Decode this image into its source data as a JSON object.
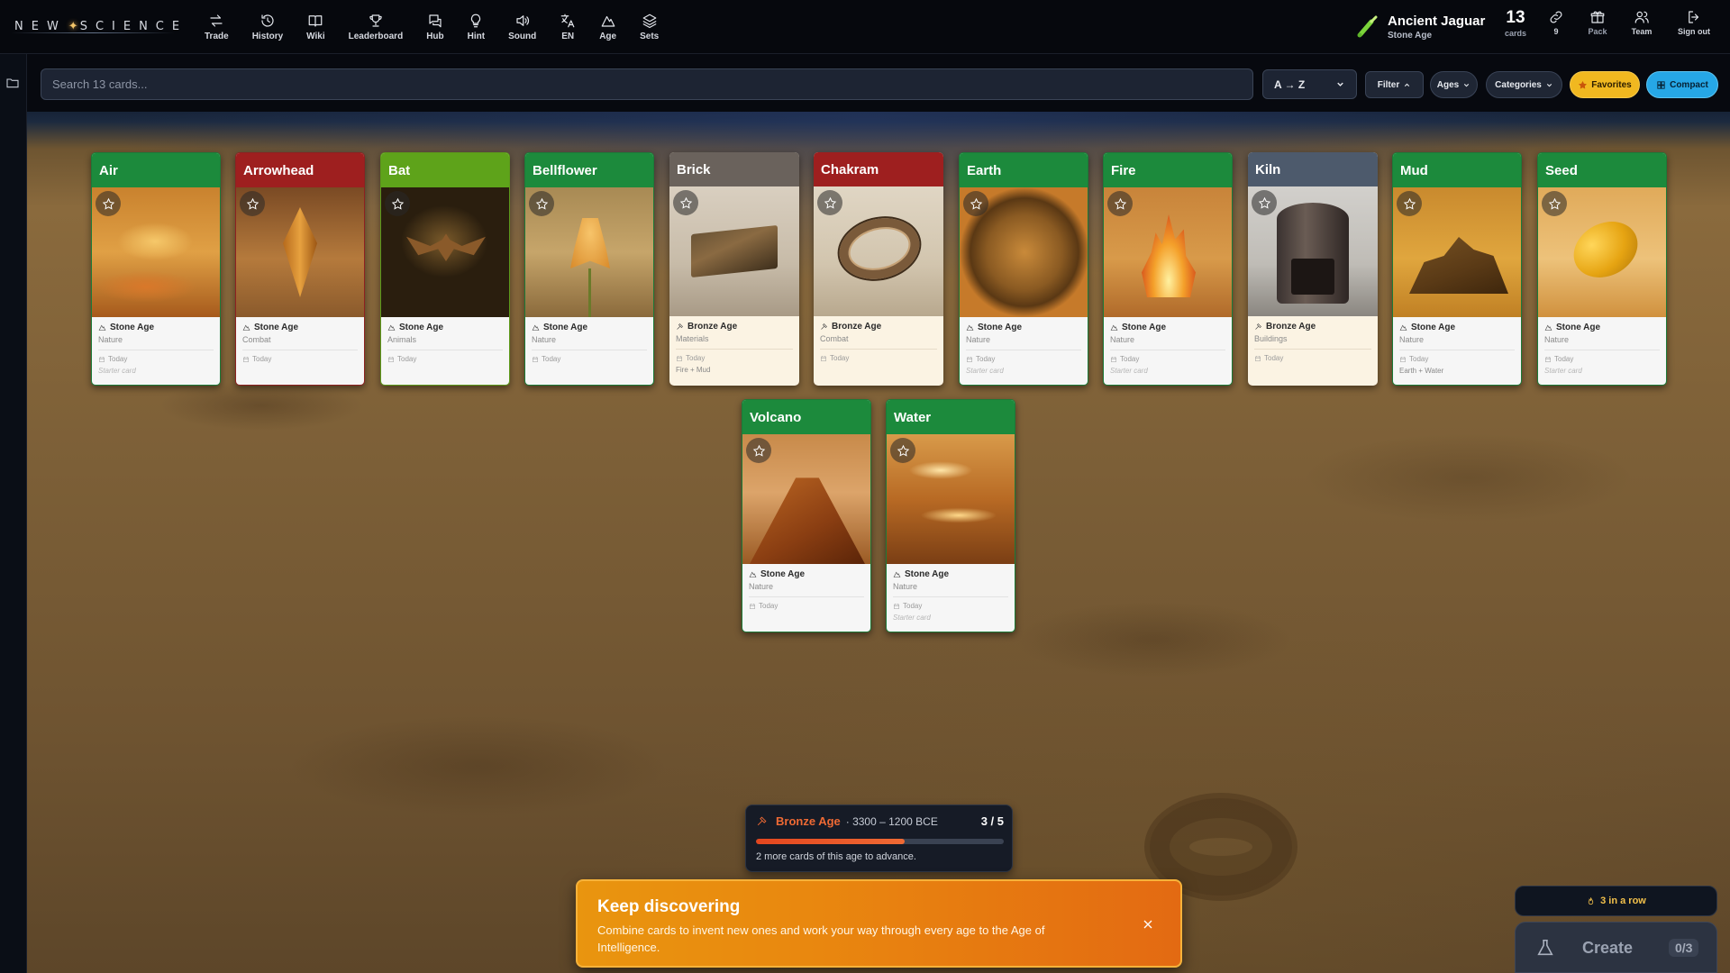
{
  "header": {
    "logo_left": "NEW",
    "logo_star": "✦",
    "logo_right": "SCIENCE",
    "nav": [
      {
        "label": "Trade",
        "icon": "arrows-exchange-icon"
      },
      {
        "label": "History",
        "icon": "history-icon"
      },
      {
        "label": "Wiki",
        "icon": "book-icon"
      },
      {
        "label": "Leaderboard",
        "icon": "trophy-icon"
      },
      {
        "label": "Hub",
        "icon": "chat-icon"
      },
      {
        "label": "Hint",
        "icon": "lightbulb-icon"
      },
      {
        "label": "Sound",
        "icon": "speaker-icon"
      },
      {
        "label": "EN",
        "icon": "translate-icon"
      },
      {
        "label": "Age",
        "icon": "mountain-icon"
      },
      {
        "label": "Sets",
        "icon": "layers-icon"
      }
    ],
    "user": {
      "name": "Ancient Jaguar",
      "age": "Stone Age"
    },
    "cards_count": "13",
    "cards_label": "cards",
    "links_count": "9",
    "pack_label": "Pack",
    "team_label": "Team",
    "signout_label": "Sign out"
  },
  "toolbar": {
    "search_placeholder": "Search 13 cards...",
    "sort_value": "A → Z",
    "filter_label": "Filter",
    "ages_label": "Ages",
    "categories_label": "Categories",
    "favorites_label": "Favorites",
    "compact_label": "Compact"
  },
  "colors": {
    "nature_green": "#1c8a3c",
    "combat_red": "#9e1f1f",
    "animals_lime": "#5ea31a",
    "materials_gray": "#6a625c",
    "buildings_slate": "#4d5a6c",
    "bronze_accent": "#ef6a34",
    "favorites_yellow": "#f1b820",
    "compact_blue": "#26a7e6"
  },
  "cards": [
    {
      "name": "Air",
      "age": "Stone Age",
      "category": "Nature",
      "date": "Today",
      "note": "Starter card"
    },
    {
      "name": "Arrowhead",
      "age": "Stone Age",
      "category": "Combat",
      "date": "Today",
      "note": ""
    },
    {
      "name": "Bat",
      "age": "Stone Age",
      "category": "Animals",
      "date": "Today",
      "note": ""
    },
    {
      "name": "Bellflower",
      "age": "Stone Age",
      "category": "Nature",
      "date": "Today",
      "note": ""
    },
    {
      "name": "Brick",
      "age": "Bronze Age",
      "category": "Materials",
      "date": "Today",
      "note": "Fire + Mud"
    },
    {
      "name": "Chakram",
      "age": "Bronze Age",
      "category": "Combat",
      "date": "Today",
      "note": ""
    },
    {
      "name": "Earth",
      "age": "Stone Age",
      "category": "Nature",
      "date": "Today",
      "note": "Starter card"
    },
    {
      "name": "Fire",
      "age": "Stone Age",
      "category": "Nature",
      "date": "Today",
      "note": "Starter card"
    },
    {
      "name": "Kiln",
      "age": "Bronze Age",
      "category": "Buildings",
      "date": "Today",
      "note": ""
    },
    {
      "name": "Mud",
      "age": "Stone Age",
      "category": "Nature",
      "date": "Today",
      "note": "Earth + Water"
    },
    {
      "name": "Seed",
      "age": "Stone Age",
      "category": "Nature",
      "date": "Today",
      "note": "Starter card"
    },
    {
      "name": "Volcano",
      "age": "Stone Age",
      "category": "Nature",
      "date": "Today",
      "note": ""
    },
    {
      "name": "Water",
      "age": "Stone Age",
      "category": "Nature",
      "date": "Today",
      "note": "Starter card"
    }
  ],
  "progress": {
    "age": "Bronze Age",
    "range": "· 3300 – 1200 BCE",
    "count": "3  /  5",
    "fraction": 0.6,
    "hint": "2 more cards of this age to advance."
  },
  "toast": {
    "title": "Keep discovering",
    "body": "Combine cards to invent new ones and work your way through every age to the Age of Intelligence."
  },
  "streak": {
    "label": "3 in a row"
  },
  "create": {
    "label": "Create",
    "count": "0/3"
  }
}
